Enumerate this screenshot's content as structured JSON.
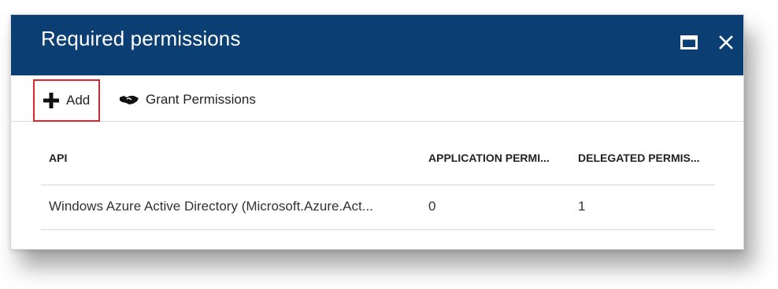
{
  "blade": {
    "title": "Required permissions",
    "controls": {
      "maximize_icon": "maximize-icon",
      "close_icon": "close-icon"
    }
  },
  "toolbar": {
    "add_label": "Add",
    "add_icon": "plus-icon",
    "grant_label": "Grant Permissions",
    "grant_icon": "handshake-icon"
  },
  "table": {
    "columns": [
      "API",
      "APPLICATION PERMI...",
      "DELEGATED PERMIS..."
    ],
    "rows": [
      {
        "api": "Windows Azure Active Directory (Microsoft.Azure.Act...",
        "application_permissions": "0",
        "delegated_permissions": "1"
      }
    ]
  },
  "colors": {
    "header_bg": "#0b3f73",
    "highlight_border": "#e0242c"
  }
}
